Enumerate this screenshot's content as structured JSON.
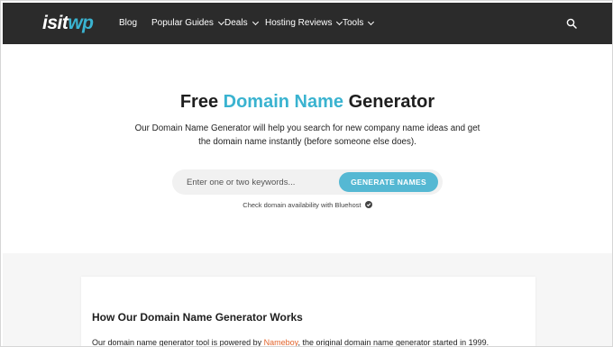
{
  "brand": {
    "logo_main": "isit",
    "logo_accent": "wp"
  },
  "nav": {
    "items": [
      {
        "label": "Blog",
        "has_dropdown": false
      },
      {
        "label": "Popular Guides",
        "has_dropdown": true
      },
      {
        "label": "Deals",
        "has_dropdown": true
      },
      {
        "label": "Hosting Reviews",
        "has_dropdown": true
      },
      {
        "label": "Tools",
        "has_dropdown": true
      }
    ],
    "search_icon": "search-icon"
  },
  "hero": {
    "title_before": "Free ",
    "title_highlight": "Domain Name",
    "title_after": " Generator",
    "description": "Our Domain Name Generator will help you search for new company name ideas and get the domain name instantly (before someone else does).",
    "input_value": "",
    "input_placeholder": "Enter one or two keywords...",
    "button_label": "GENERATE NAMES",
    "check_text": "Check domain availability with Bluehost",
    "check_icon": "check-circle-icon"
  },
  "content": {
    "heading": "How Our Domain Name Generator Works",
    "text_before": "Our domain name generator tool is powered by ",
    "link_text": "Nameboy",
    "text_after": ", the original domain name generator started in 1999."
  },
  "colors": {
    "navbar_bg": "#2b2b2b",
    "accent": "#3ab3d0",
    "button_bg": "#55b8d3",
    "link": "#e2642c",
    "section_bg": "#f6f6f6"
  }
}
